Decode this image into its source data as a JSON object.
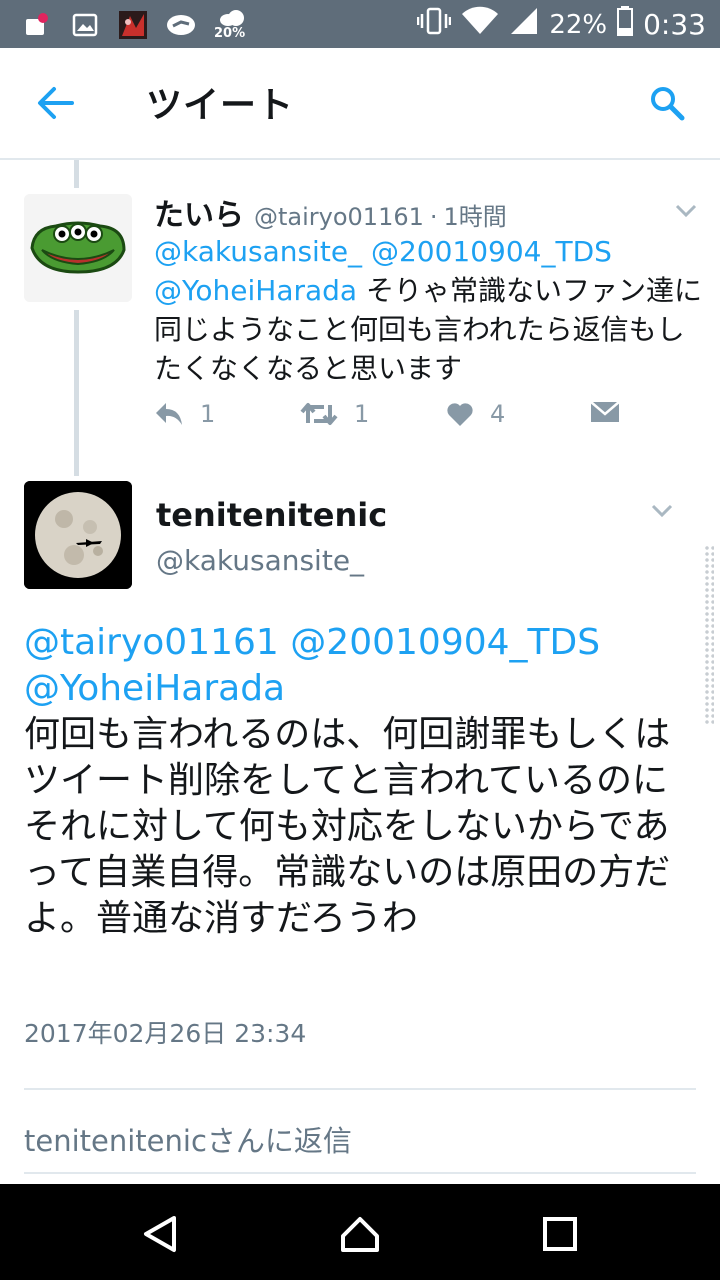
{
  "status_bar": {
    "weather_percent": "20%",
    "battery": "22%",
    "time": "0:33"
  },
  "app_bar": {
    "title": "ツイート"
  },
  "reply_tweet": {
    "name": "たいら",
    "handle": "@tairyo01161",
    "separator": "·",
    "time": "1時間",
    "mentions": [
      "@kakusansite_",
      "@20010904_TDS",
      "@YoheiHarada"
    ],
    "text": "そりゃ常識ないファン達に同じようなこと何回も言われたら返信もしたくなくなると思います",
    "reply_count": "1",
    "retweet_count": "1",
    "like_count": "4"
  },
  "main_tweet": {
    "name": "tenitenitenic",
    "handle": "@kakusansite_",
    "mentions": [
      "@tairyo01161",
      "@20010904_TDS",
      "@YoheiHarada"
    ],
    "text": "何回も言われるのは、何回謝罪もしくはツイート削除をしてと言われているのにそれに対して何も対応をしないからであって自業自得。常識ないのは原田の方だよ。普通な消すだろうわ",
    "timestamp": "2017年02月26日 23:34"
  },
  "reply_box": {
    "placeholder": "tenitenitenicさんに返信"
  },
  "icons": {
    "back": "arrow-left-icon",
    "search": "search-icon",
    "more": "chevron-down-icon",
    "reply": "reply-icon",
    "retweet": "retweet-icon",
    "like": "heart-icon",
    "dm": "envelope-icon"
  },
  "colors": {
    "accent": "#1da1f2",
    "status_bar": "#5f6d7a",
    "muted": "#657786",
    "action": "#8899a6"
  }
}
